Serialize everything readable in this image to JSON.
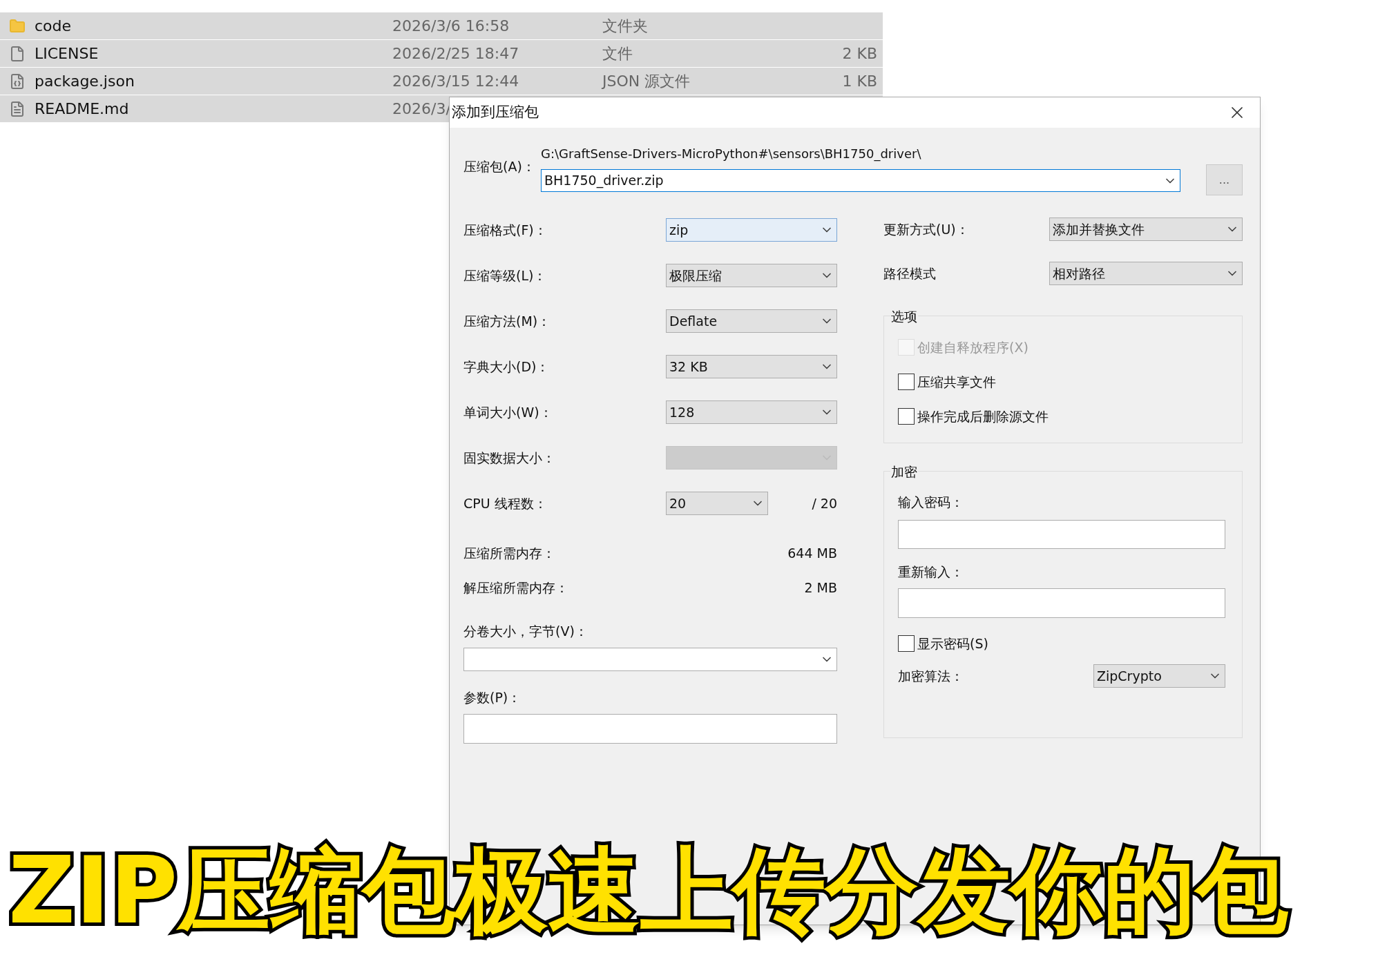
{
  "file_list": {
    "rows": [
      {
        "kind": "folder",
        "name": "code",
        "date": "2026/3/6 16:58",
        "type": "文件夹",
        "selected": true
      },
      {
        "kind": "file",
        "name": "LICENSE",
        "date": "2026/2/25 18:47",
        "type": "文件",
        "size": "2 KB",
        "selected": true
      },
      {
        "kind": "json",
        "name": "package.json",
        "date": "2026/3/15 12:44",
        "type": "JSON 源文件",
        "size": "1 KB",
        "selected": true
      },
      {
        "kind": "markdown",
        "name": "README.md",
        "date": "2026/3/",
        "selected": true
      }
    ]
  },
  "dialog": {
    "title": "添加到压缩包",
    "archive": {
      "label": "压缩包(A)：",
      "path": "G:\\GraftSense-Drivers-MicroPython#\\sensors\\BH1750_driver\\",
      "value": "BH1750_driver.zip",
      "browse": "..."
    },
    "left_fields": [
      {
        "kind": "combo",
        "label": "压缩格式(F)：",
        "value": "zip",
        "focused": true,
        "disabled": false
      },
      {
        "kind": "combo",
        "label": "压缩等级(L)：",
        "value": "极限压缩",
        "focused": false,
        "disabled": false
      },
      {
        "kind": "combo",
        "label": "压缩方法(M)：",
        "value": "Deflate",
        "focused": false,
        "disabled": false
      },
      {
        "kind": "combo",
        "label": "字典大小(D)：",
        "value": "32 KB",
        "focused": false,
        "disabled": false
      },
      {
        "kind": "combo",
        "label": "单词大小(W)：",
        "value": "128",
        "focused": false,
        "disabled": false
      },
      {
        "kind": "combo",
        "label": "固实数据大小：",
        "focused": false,
        "disabled": true
      },
      {
        "kind": "threads",
        "label": "CPU 线程数：",
        "value": "20",
        "max": "/ 20",
        "focused": false,
        "disabled": false
      },
      {
        "kind": "reading",
        "label": "压缩所需内存：",
        "value": "644 MB"
      },
      {
        "kind": "reading",
        "label": "解压缩所需内存：",
        "value": "2 MB"
      }
    ],
    "volume": {
      "label": "分卷大小，字节(V)："
    },
    "params": {
      "label": "参数(P)："
    },
    "right_fields": [
      {
        "label": "更新方式(U)：",
        "value": "添加并替换文件"
      },
      {
        "label": "路径模式",
        "value": "相对路径"
      }
    ],
    "options": {
      "title": "选项",
      "items": [
        {
          "label": "创建自释放程序(X)",
          "checked": false,
          "disabled": true
        },
        {
          "label": "压缩共享文件",
          "checked": false,
          "disabled": false
        },
        {
          "label": "操作完成后删除源文件",
          "checked": false,
          "disabled": false
        }
      ]
    },
    "encryption": {
      "title": "加密",
      "password_label": "输入密码：",
      "repeat_label": "重新输入：",
      "show_password": {
        "label": "显示密码(S)",
        "checked": false
      },
      "method_label": "加密算法：",
      "method": "ZipCrypto"
    }
  },
  "caption": "ZIP压缩包极速上传分发你的包"
}
